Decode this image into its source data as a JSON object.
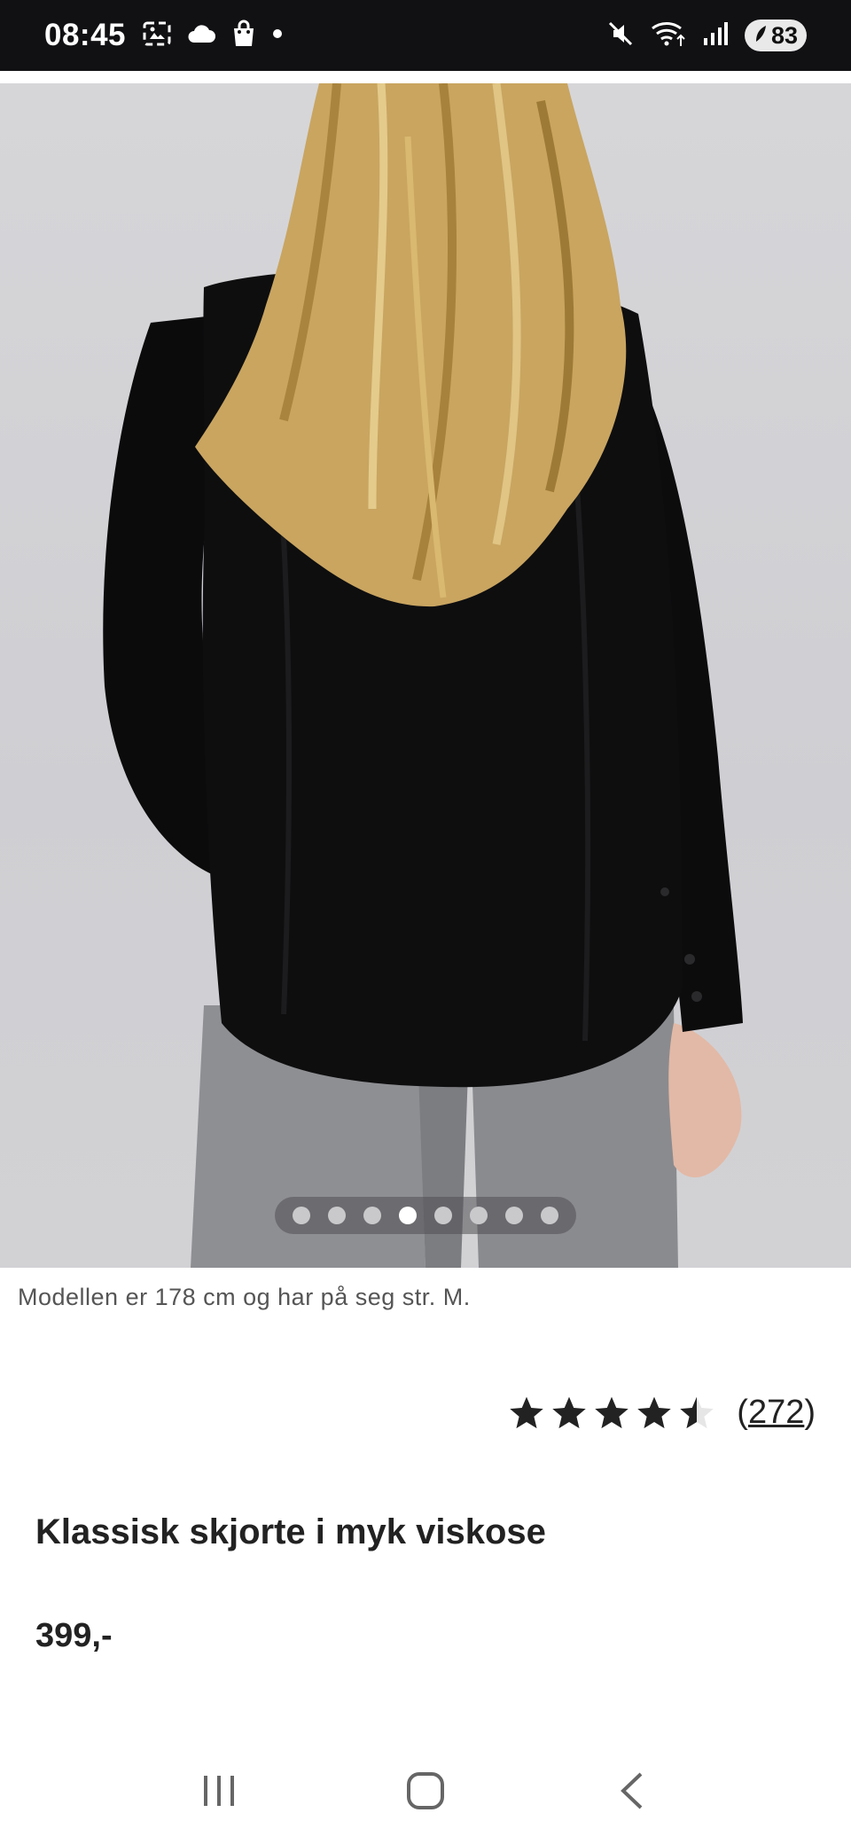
{
  "status_bar": {
    "time": "08:45",
    "battery_level": "83",
    "icons": [
      "screenshot-icon",
      "cloud-icon",
      "shopping-bag-icon",
      "notification-dot-icon",
      "mute-icon",
      "wifi-icon",
      "signal-icon",
      "battery-icon"
    ]
  },
  "product": {
    "image_carousel": {
      "total": 8,
      "active_index": 3
    },
    "model_caption": "Modellen er 178 cm og har på seg str. M.",
    "rating": {
      "stars": 4.5,
      "max": 5,
      "open_paren": "(",
      "count": "272",
      "close_paren": ")"
    },
    "title": "Klassisk skjorte i myk viskose",
    "price": "399,-"
  },
  "nav_bar": {
    "icons": [
      "recent-apps-icon",
      "home-icon",
      "back-icon"
    ]
  },
  "colors": {
    "status_bar_bg": "#111114",
    "text_primary": "#222222",
    "caption_text": "#555555",
    "star_fill": "#222222"
  }
}
